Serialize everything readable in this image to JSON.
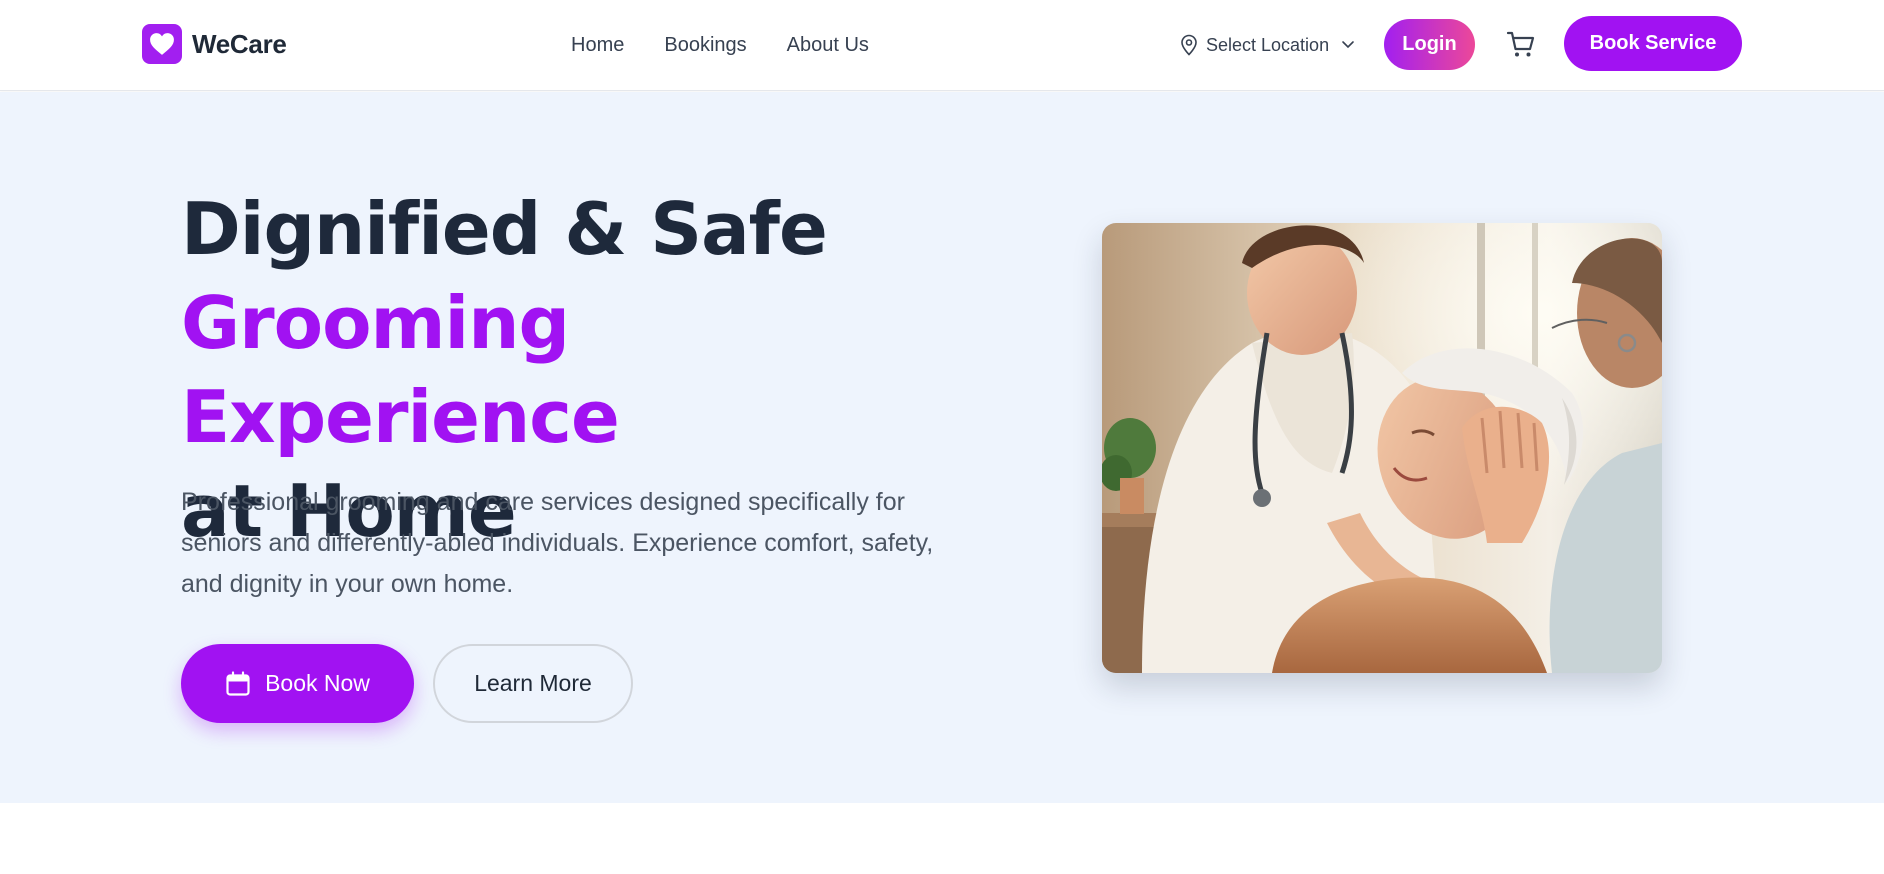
{
  "brand": {
    "name": "WeCare",
    "logo_icon": "heart-icon",
    "color": "#a21ff0"
  },
  "nav": {
    "links": [
      {
        "label": "Home"
      },
      {
        "label": "Bookings"
      },
      {
        "label": "About Us"
      }
    ],
    "location": {
      "label": "Select Location",
      "icon": "map-pin-icon",
      "dropdown_icon": "chevron-down-icon"
    },
    "login_label": "Login",
    "cart_icon": "shopping-cart-icon",
    "book_service_label": "Book Service"
  },
  "hero": {
    "headline_line1": "Dignified & Safe",
    "headline_accent": "Grooming Experience",
    "headline_line3": "at Home",
    "description": "Professional grooming and care services designed specifically for seniors and differently-abled individuals. Experience comfort, safety, and dignity in your own home.",
    "primary_button": {
      "label": "Book Now",
      "icon": "calendar-icon"
    },
    "secondary_button": {
      "label": "Learn More"
    },
    "image_icon": "caregiver-photo"
  },
  "colors": {
    "accent": "#a112f2",
    "login_gradient_start": "#a21ff0",
    "login_gradient_end": "#ec4899",
    "hero_bg": "#eef4fd",
    "headline": "#1e293b"
  }
}
